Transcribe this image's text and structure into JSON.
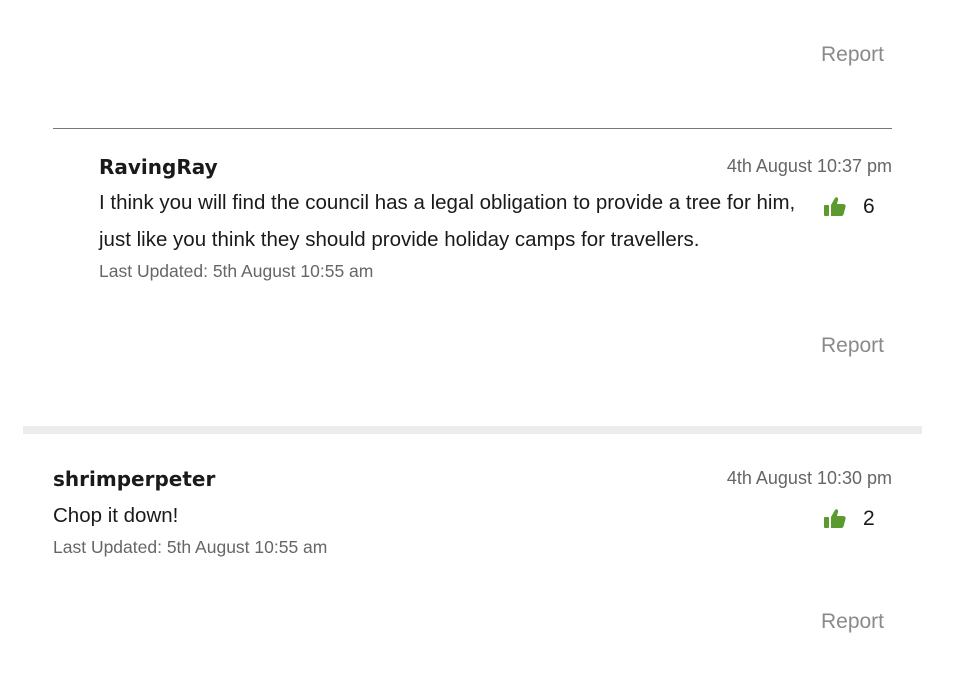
{
  "top": {
    "report_label": "Report"
  },
  "comments": [
    {
      "author": "RavingRay",
      "timestamp": "4th August 10:37 pm",
      "body": "I think you will find the council has a legal obligation to provide a tree for him, just like you think they should provide holiday camps for travellers.",
      "updated": "Last Updated: 5th August 10:55 am",
      "likes": "6",
      "report_label": "Report"
    },
    {
      "author": "shrimperpeter",
      "timestamp": "4th August 10:30 pm",
      "body": "Chop it down!",
      "updated": "Last Updated: 5th August 10:55 am",
      "likes": "2",
      "report_label": "Report"
    }
  ],
  "icons": {
    "like": "thumbs-up-icon"
  },
  "colors": {
    "like_green": "#5a9a2e",
    "muted_text": "#8a8a8a"
  }
}
